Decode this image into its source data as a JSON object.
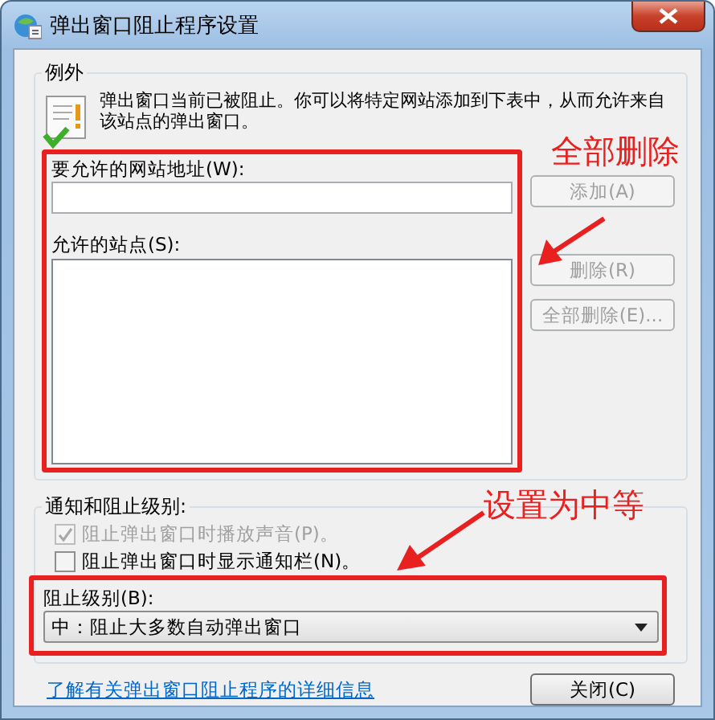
{
  "window": {
    "title": "弹出窗口阻止程序设置"
  },
  "exceptions": {
    "legend": "例外",
    "intro": "弹出窗口当前已被阻止。你可以将特定网站添加到下表中，从而允许来自该站点的弹出窗口。",
    "address_label": "要允许的网站地址(W):",
    "sites_label": "允许的站点(S):",
    "buttons": [
      {
        "label": "添加(A)",
        "disabled": true
      },
      {
        "label": "删除(R)",
        "disabled": true
      },
      {
        "label": "全部删除(E)...",
        "disabled": true
      }
    ]
  },
  "notification": {
    "legend": "通知和阻止级别:",
    "options": [
      {
        "label": "阻止弹出窗口时播放声音(P)。",
        "checked": true,
        "disabled": true
      },
      {
        "label": "阻止弹出窗口时显示通知栏(N)。",
        "checked": false,
        "disabled": false
      }
    ],
    "level_label": "阻止级别(B):",
    "level_value": "中：阻止大多数自动弹出窗口"
  },
  "footer": {
    "link": "了解有关弹出窗口阻止程序的详细信息",
    "close_button": "关闭(C)"
  },
  "annotations": [
    {
      "text": "全部删除"
    },
    {
      "text": "设置为中等"
    }
  ]
}
